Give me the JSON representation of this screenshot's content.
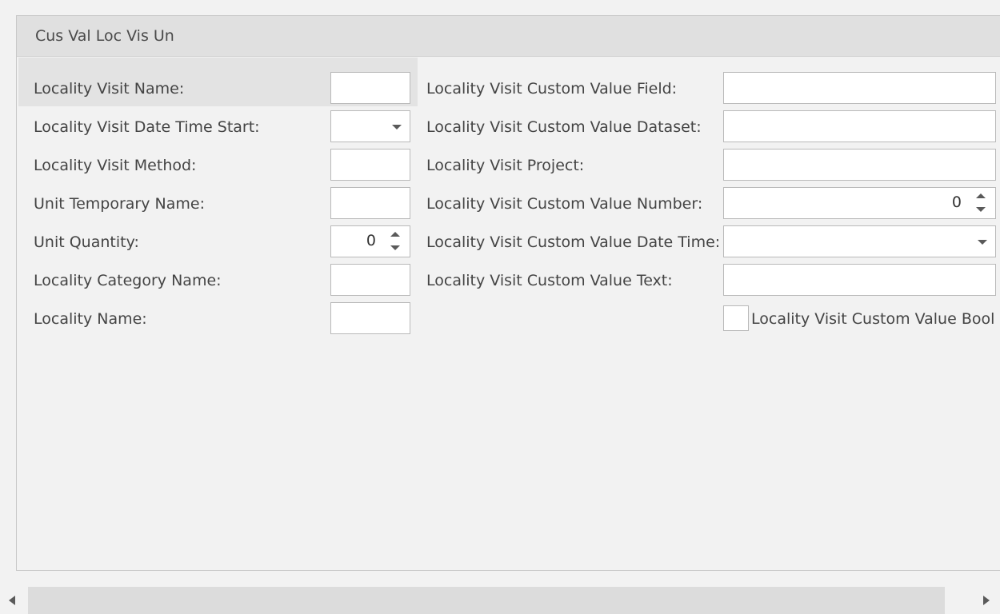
{
  "group": {
    "title": "Cus Val Loc Vis Un"
  },
  "left": {
    "locality_visit_name": {
      "label": "Locality Visit Name:",
      "value": ""
    },
    "date_time_start": {
      "label": "Locality Visit Date Time Start:",
      "value": ""
    },
    "method": {
      "label": "Locality Visit Method:",
      "value": ""
    },
    "unit_temporary_name": {
      "label": "Unit Temporary Name:",
      "value": ""
    },
    "unit_quantity": {
      "label": "Unit Quantity:",
      "value": "0"
    },
    "locality_category_name": {
      "label": "Locality Category Name:",
      "value": ""
    },
    "locality_name": {
      "label": "Locality Name:",
      "value": ""
    }
  },
  "right": {
    "custom_value_field": {
      "label": "Locality Visit Custom Value Field:",
      "value": ""
    },
    "custom_value_dataset": {
      "label": "Locality Visit Custom Value Dataset:",
      "value": ""
    },
    "project": {
      "label": "Locality Visit Project:",
      "value": ""
    },
    "custom_value_number": {
      "label": "Locality Visit Custom Value Number:",
      "value": "0"
    },
    "custom_value_date_time": {
      "label": "Locality Visit Custom Value Date Time:",
      "value": ""
    },
    "custom_value_text": {
      "label": "Locality Visit Custom Value Text:",
      "value": ""
    },
    "custom_value_bool": {
      "label": "Locality Visit Custom Value Bool",
      "checked": false
    }
  }
}
